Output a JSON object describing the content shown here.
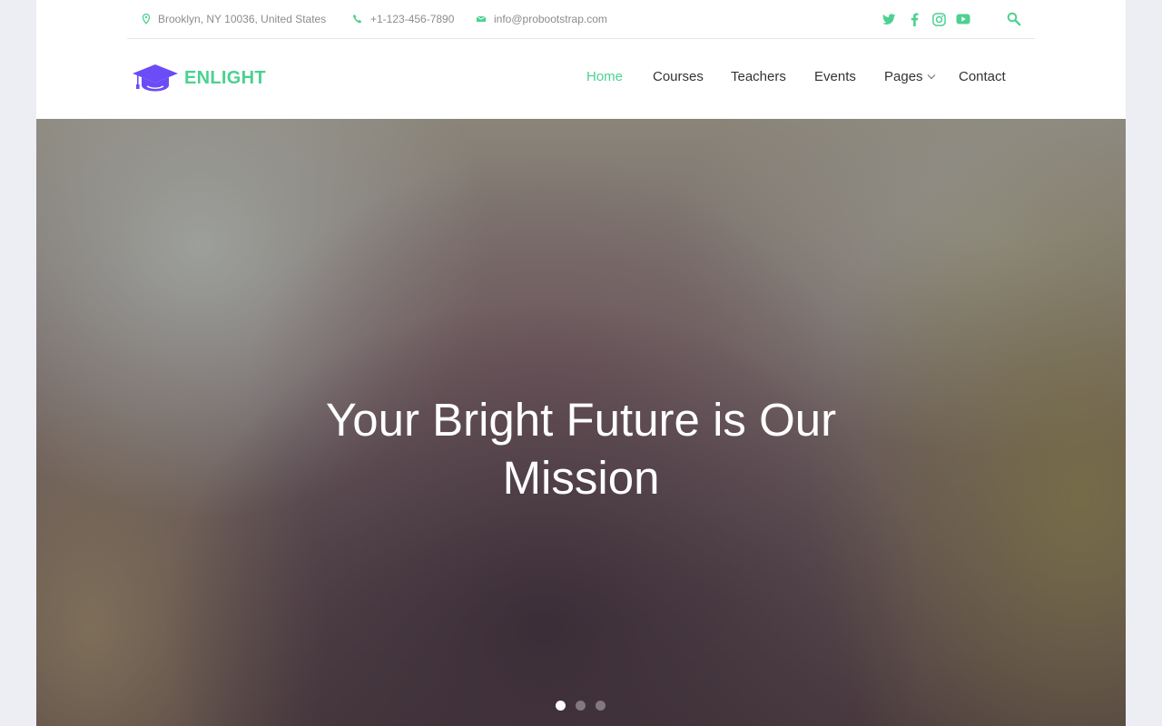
{
  "colors": {
    "accent": "#4cd191",
    "brand_icon": "#6c4cf6",
    "text": "#333333",
    "muted": "#8c8c8c"
  },
  "topbar": {
    "address": "Brooklyn, NY 10036, United States",
    "phone": "+1-123-456-7890",
    "email": "info@probootstrap.com",
    "icons": [
      "map-pin-icon",
      "phone-icon",
      "mail-icon",
      "twitter-icon",
      "facebook-icon",
      "instagram-icon",
      "youtube-icon",
      "search-icon"
    ]
  },
  "header": {
    "logo_text": "ENLIGHT",
    "nav": [
      {
        "label": "Home",
        "active": true
      },
      {
        "label": "Courses"
      },
      {
        "label": "Teachers"
      },
      {
        "label": "Events"
      },
      {
        "label": "Pages",
        "has_dropdown": true
      },
      {
        "label": "Contact"
      }
    ]
  },
  "hero": {
    "title_line1": "Your Bright Future is Our",
    "title_line2": "Mission",
    "slides_count": 3,
    "active_slide": 1
  }
}
